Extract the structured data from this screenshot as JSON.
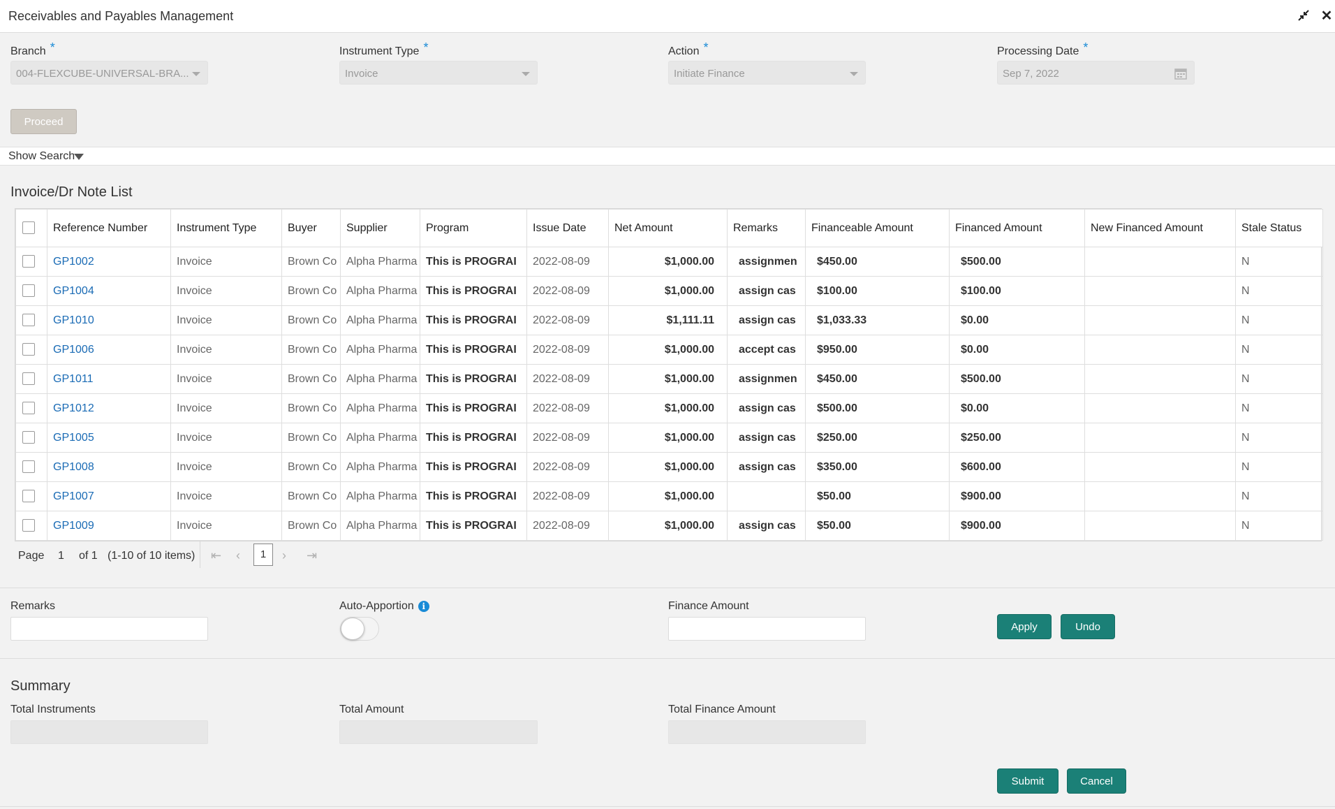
{
  "window": {
    "title": "Receivables and Payables Management"
  },
  "filters": {
    "branch": {
      "label": "Branch",
      "value": "004-FLEXCUBE-UNIVERSAL-BRA..."
    },
    "instrument_type": {
      "label": "Instrument Type",
      "value": "Invoice"
    },
    "action": {
      "label": "Action",
      "value": "Initiate Finance"
    },
    "processing_date": {
      "label": "Processing Date",
      "value": "Sep 7, 2022"
    },
    "required_marker": "*",
    "proceed_label": "Proceed"
  },
  "search": {
    "toggle_label": "Show Search"
  },
  "list": {
    "title": "Invoice/Dr Note List",
    "columns": [
      "Reference Number",
      "Instrument Type",
      "Buyer",
      "Supplier",
      "Program",
      "Issue Date",
      "Net Amount",
      "Remarks",
      "Financeable Amount",
      "Financed Amount",
      "New Financed Amount",
      "Stale Status"
    ],
    "rows": [
      {
        "ref": "GP1002",
        "type": "Invoice",
        "buyer": "Brown Co",
        "supplier": "Alpha Pharma",
        "program": "This is PROGRAI",
        "issue_date": "2022-08-09",
        "net_amount": "$1,000.00",
        "remarks": "assignmen",
        "financeable": "$450.00",
        "financed": "$500.00",
        "new_financed": "",
        "stale": "N"
      },
      {
        "ref": "GP1004",
        "type": "Invoice",
        "buyer": "Brown Co",
        "supplier": "Alpha Pharma",
        "program": "This is PROGRAI",
        "issue_date": "2022-08-09",
        "net_amount": "$1,000.00",
        "remarks": "assign cas",
        "financeable": "$100.00",
        "financed": "$100.00",
        "new_financed": "",
        "stale": "N"
      },
      {
        "ref": "GP1010",
        "type": "Invoice",
        "buyer": "Brown Co",
        "supplier": "Alpha Pharma",
        "program": "This is PROGRAI",
        "issue_date": "2022-08-09",
        "net_amount": "$1,111.11",
        "remarks": "assign cas",
        "financeable": "$1,033.33",
        "financed": "$0.00",
        "new_financed": "",
        "stale": "N"
      },
      {
        "ref": "GP1006",
        "type": "Invoice",
        "buyer": "Brown Co",
        "supplier": "Alpha Pharma",
        "program": "This is PROGRAI",
        "issue_date": "2022-08-09",
        "net_amount": "$1,000.00",
        "remarks": "accept cas",
        "financeable": "$950.00",
        "financed": "$0.00",
        "new_financed": "",
        "stale": "N"
      },
      {
        "ref": "GP1011",
        "type": "Invoice",
        "buyer": "Brown Co",
        "supplier": "Alpha Pharma",
        "program": "This is PROGRAI",
        "issue_date": "2022-08-09",
        "net_amount": "$1,000.00",
        "remarks": "assignmen",
        "financeable": "$450.00",
        "financed": "$500.00",
        "new_financed": "",
        "stale": "N"
      },
      {
        "ref": "GP1012",
        "type": "Invoice",
        "buyer": "Brown Co",
        "supplier": "Alpha Pharma",
        "program": "This is PROGRAI",
        "issue_date": "2022-08-09",
        "net_amount": "$1,000.00",
        "remarks": "assign cas",
        "financeable": "$500.00",
        "financed": "$0.00",
        "new_financed": "",
        "stale": "N"
      },
      {
        "ref": "GP1005",
        "type": "Invoice",
        "buyer": "Brown Co",
        "supplier": "Alpha Pharma",
        "program": "This is PROGRAI",
        "issue_date": "2022-08-09",
        "net_amount": "$1,000.00",
        "remarks": "assign cas",
        "financeable": "$250.00",
        "financed": "$250.00",
        "new_financed": "",
        "stale": "N"
      },
      {
        "ref": "GP1008",
        "type": "Invoice",
        "buyer": "Brown Co",
        "supplier": "Alpha Pharma",
        "program": "This is PROGRAI",
        "issue_date": "2022-08-09",
        "net_amount": "$1,000.00",
        "remarks": "assign cas",
        "financeable": "$350.00",
        "financed": "$600.00",
        "new_financed": "",
        "stale": "N"
      },
      {
        "ref": "GP1007",
        "type": "Invoice",
        "buyer": "Brown Co",
        "supplier": "Alpha Pharma",
        "program": "This is PROGRAI",
        "issue_date": "2022-08-09",
        "net_amount": "$1,000.00",
        "remarks": "",
        "financeable": "$50.00",
        "financed": "$900.00",
        "new_financed": "",
        "stale": "N"
      },
      {
        "ref": "GP1009",
        "type": "Invoice",
        "buyer": "Brown Co",
        "supplier": "Alpha Pharma",
        "program": "This is PROGRAI",
        "issue_date": "2022-08-09",
        "net_amount": "$1,000.00",
        "remarks": "assign cas",
        "financeable": "$50.00",
        "financed": "$900.00",
        "new_financed": "",
        "stale": "N"
      }
    ]
  },
  "pagination": {
    "page_label": "Page",
    "page_number": "1",
    "of_label": "of 1",
    "items_label": "(1-10 of 10 items)",
    "current": "1"
  },
  "finance": {
    "remarks_label": "Remarks",
    "remarks_value": "",
    "auto_apportion_label": "Auto-Apportion",
    "auto_apportion_on": false,
    "finance_amount_label": "Finance Amount",
    "finance_amount_value": "",
    "apply_label": "Apply",
    "undo_label": "Undo"
  },
  "summary": {
    "title": "Summary",
    "total_instruments_label": "Total Instruments",
    "total_instruments_value": "",
    "total_amount_label": "Total Amount",
    "total_amount_value": "",
    "total_finance_amount_label": "Total Finance Amount",
    "total_finance_amount_value": ""
  },
  "footer": {
    "submit_label": "Submit",
    "cancel_label": "Cancel"
  },
  "colors": {
    "accent": "#1b8077",
    "link": "#1a6bb5",
    "required": "#1a8bd6"
  }
}
